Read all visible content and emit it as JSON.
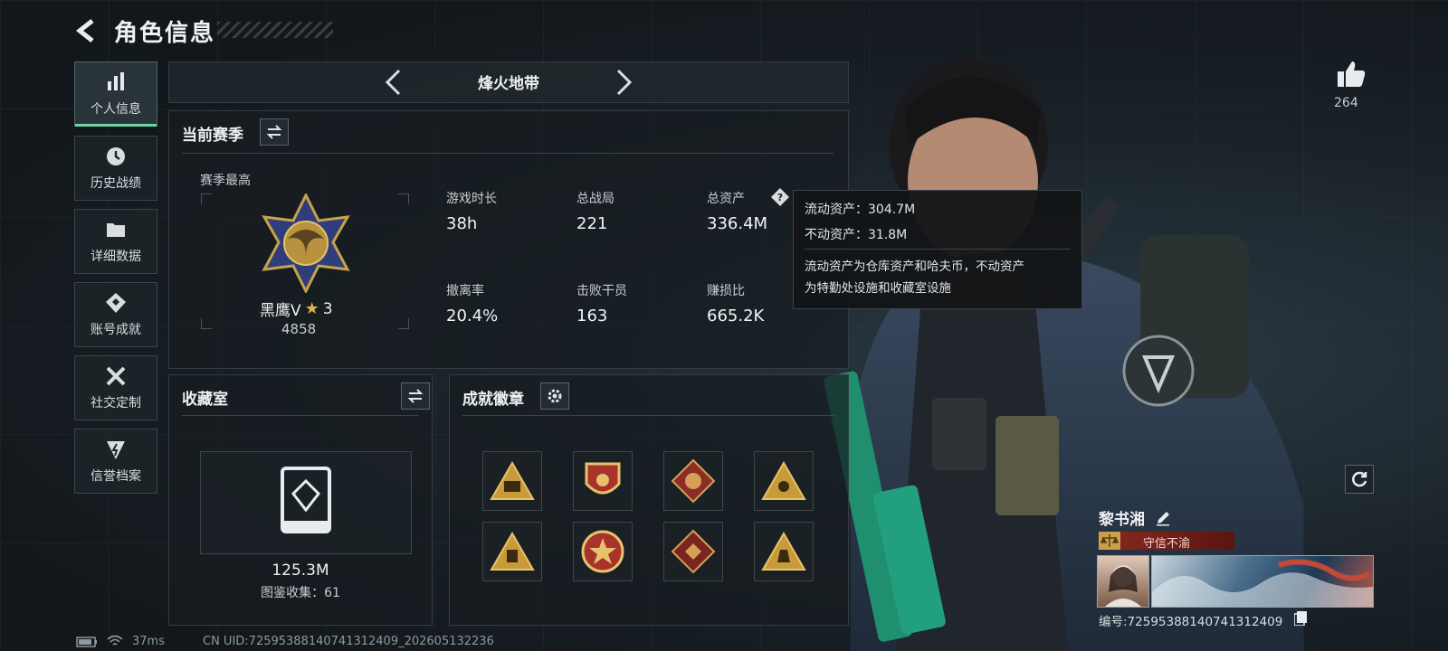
{
  "header": {
    "title": "角色信息"
  },
  "sidebar": {
    "items": [
      {
        "label": "个人信息",
        "icon": "bar-chart-icon",
        "active": true
      },
      {
        "label": "历史战绩",
        "icon": "clock-history-icon",
        "active": false
      },
      {
        "label": "详细数据",
        "icon": "folder-icon",
        "active": false
      },
      {
        "label": "账号成就",
        "icon": "achievement-icon",
        "active": false
      },
      {
        "label": "社交定制",
        "icon": "tools-icon",
        "active": false
      },
      {
        "label": "信誉档案",
        "icon": "shield-bolt-icon",
        "active": false
      }
    ]
  },
  "mode_tab": {
    "title": "烽火地带"
  },
  "season": {
    "section_title": "当前赛季",
    "best_label": "赛季最高",
    "rank_name": "黑鹰Ⅴ",
    "rank_stars": "3",
    "rank_score": "4858",
    "stats": [
      {
        "label": "游戏时长",
        "value": "38h"
      },
      {
        "label": "总战局",
        "value": "221"
      },
      {
        "label": "总资产",
        "value": "336.4M"
      },
      {
        "label": "撤离率",
        "value": "20.4%"
      },
      {
        "label": "击败干员",
        "value": "163"
      },
      {
        "label": "赚损比",
        "value": "665.2K"
      }
    ]
  },
  "tooltip": {
    "liquid": "流动资产：304.7M",
    "fixed": "不动资产：31.8M",
    "desc_line1": "流动资产为仓库资产和哈夫币，不动资产",
    "desc_line2": "为特勤处设施和收藏室设施"
  },
  "collection": {
    "title": "收藏室",
    "value": "125.3M",
    "count": "图鉴收集：61"
  },
  "achievements": {
    "title": "成就徽章"
  },
  "likes": {
    "count": "264"
  },
  "player": {
    "name": "黎书湘",
    "title_badge": "守信不渝",
    "id": "编号:7259538814074131240​9"
  },
  "status_bar": {
    "ping": "37ms",
    "uid": "CN UID:7259538814074131240​9_202605132236"
  },
  "colors": {
    "accent": "#6dd7a6",
    "gold": "#c8a24a",
    "red_badge": "#7a1e1e"
  }
}
